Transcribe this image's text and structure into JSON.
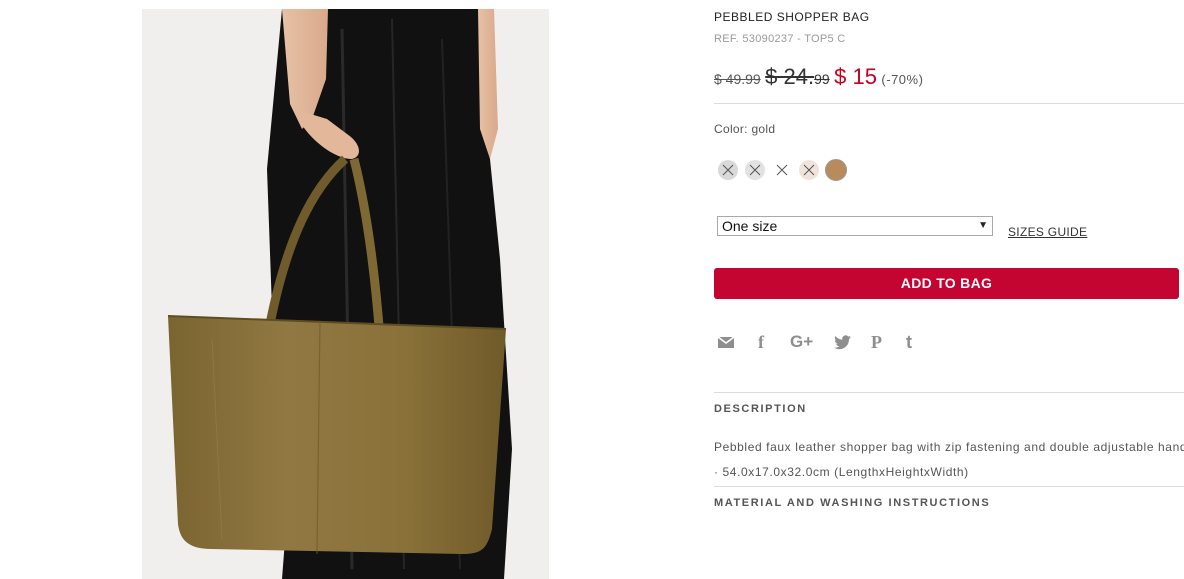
{
  "product": {
    "title": "PEBBLED SHOPPER BAG",
    "ref": "REF. 53090237 - TOP5 C",
    "price_original": "$ 49.99",
    "price_previous_main": "$ 24.",
    "price_previous_cents": "99",
    "price_sale": "$ 15",
    "discount": "(-70%)",
    "color_label": "Color: gold",
    "swatches": [
      {
        "name": "grey",
        "color": "#d9d9d9",
        "available": false
      },
      {
        "name": "light-grey",
        "color": "#e2e2e2",
        "available": false
      },
      {
        "name": "white",
        "color": "#ffffff",
        "available": false
      },
      {
        "name": "blush",
        "color": "#f1e2dc",
        "available": false
      },
      {
        "name": "gold",
        "color": "#b98a5c",
        "available": true,
        "selected": true
      }
    ],
    "size_selected": "One size",
    "sizes_guide": "SIZES GUIDE",
    "add_to_bag": "ADD TO BAG",
    "share_icons": [
      "email-icon",
      "facebook-icon",
      "google-plus-icon",
      "twitter-icon",
      "pinterest-icon",
      "tumblr-icon"
    ],
    "share_glyphs": {
      "facebook": "f",
      "google_plus": "G+",
      "pinterest": "P",
      "tumblr": "t"
    },
    "description_heading": "DESCRIPTION",
    "description_text": "Pebbled faux leather shopper bag with zip fastening and double adjustable handles.",
    "dimensions": "· 54.0x17.0x32.0cm (LengthxHeightxWidth)",
    "material_heading": "MATERIAL AND WASHING INSTRUCTIONS"
  },
  "colors": {
    "accent": "#c40431",
    "sale_price": "#c6001f",
    "icon_grey": "#8e8e8e"
  }
}
